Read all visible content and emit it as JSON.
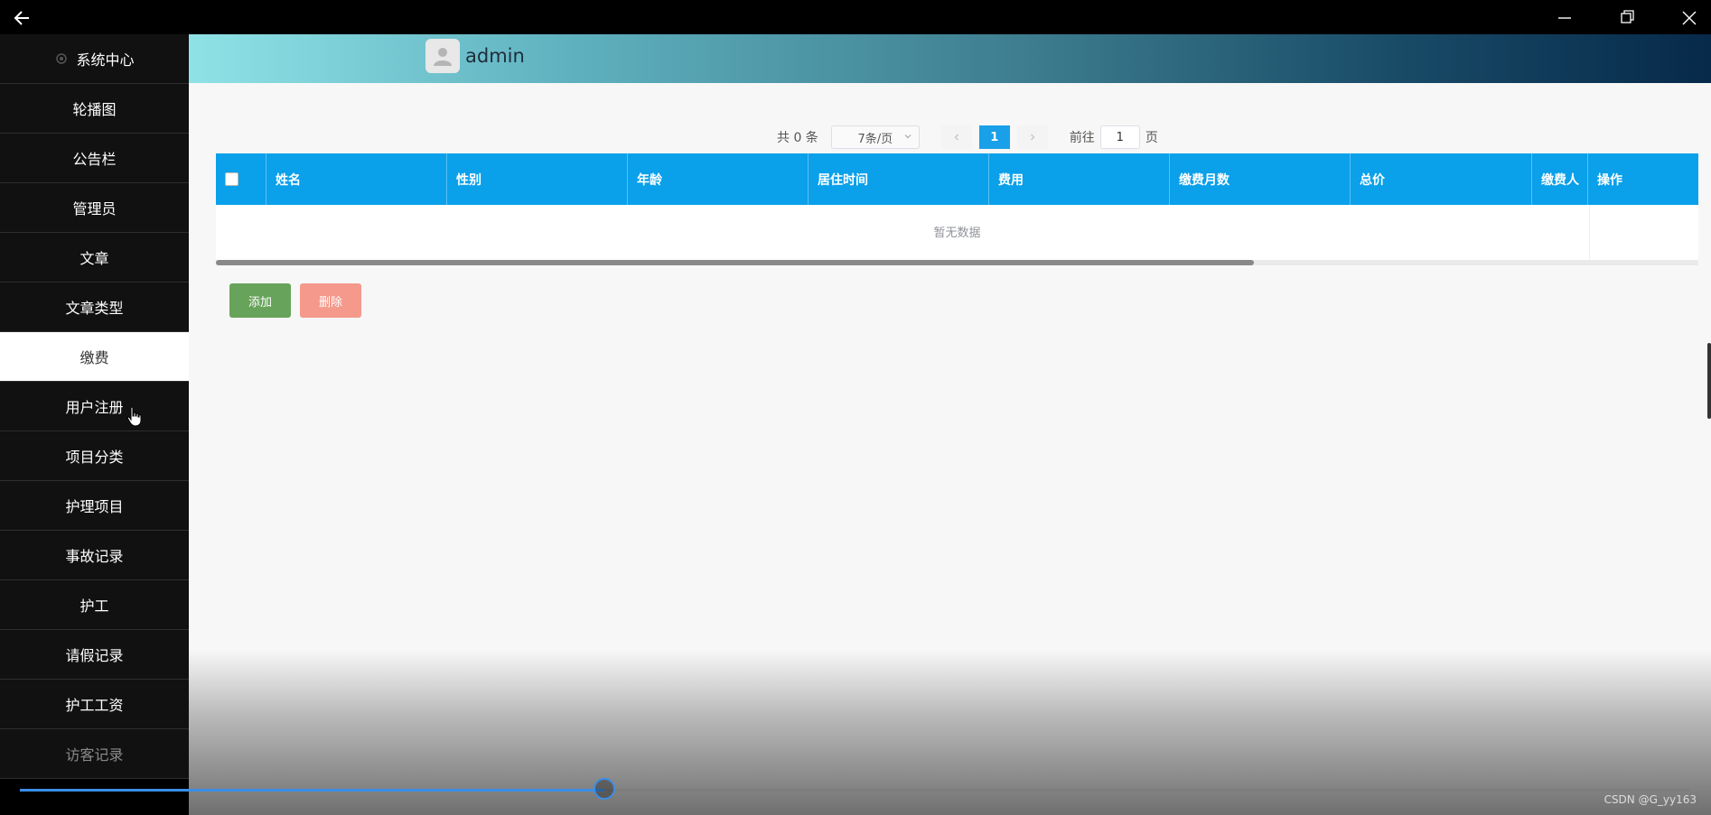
{
  "window": {
    "back_icon": "arrow-left-icon",
    "minimize_icon": "minimize-icon",
    "restore_icon": "restore-icon",
    "close_icon": "close-icon"
  },
  "sidebar": {
    "items": [
      {
        "label": "系统中心",
        "icon": "gear-icon"
      },
      {
        "label": "轮播图"
      },
      {
        "label": "公告栏"
      },
      {
        "label": "管理员"
      },
      {
        "label": "文章"
      },
      {
        "label": "文章类型"
      },
      {
        "label": "缴费",
        "active": true
      },
      {
        "label": "用户注册"
      },
      {
        "label": "项目分类"
      },
      {
        "label": "护理项目"
      },
      {
        "label": "事故记录"
      },
      {
        "label": "护工"
      },
      {
        "label": "请假记录"
      },
      {
        "label": "护工工资"
      },
      {
        "label": "访客记录"
      }
    ]
  },
  "header": {
    "username": "admin",
    "avatar_icon": "user-avatar-icon"
  },
  "pagination": {
    "total_text": "共 0 条",
    "page_size": "7条/页",
    "current_page": "1",
    "goto_label": "前往",
    "goto_value": "1",
    "page_suffix": "页"
  },
  "table": {
    "columns": [
      "姓名",
      "性别",
      "年龄",
      "居住时间",
      "费用",
      "缴费月数",
      "总价",
      "缴费人",
      "操作"
    ],
    "empty_text": "暂无数据",
    "scroll_fraction": 0.7
  },
  "actions": {
    "add_label": "添加",
    "delete_label": "删除"
  },
  "player": {
    "progress_fraction": 0.35,
    "watermark": "CSDN @G_yy163"
  },
  "colors": {
    "table_header": "#0aa0ea",
    "add_button": "#67a35a",
    "delete_button": "#f4998b",
    "progress": "#3a8ee6"
  }
}
